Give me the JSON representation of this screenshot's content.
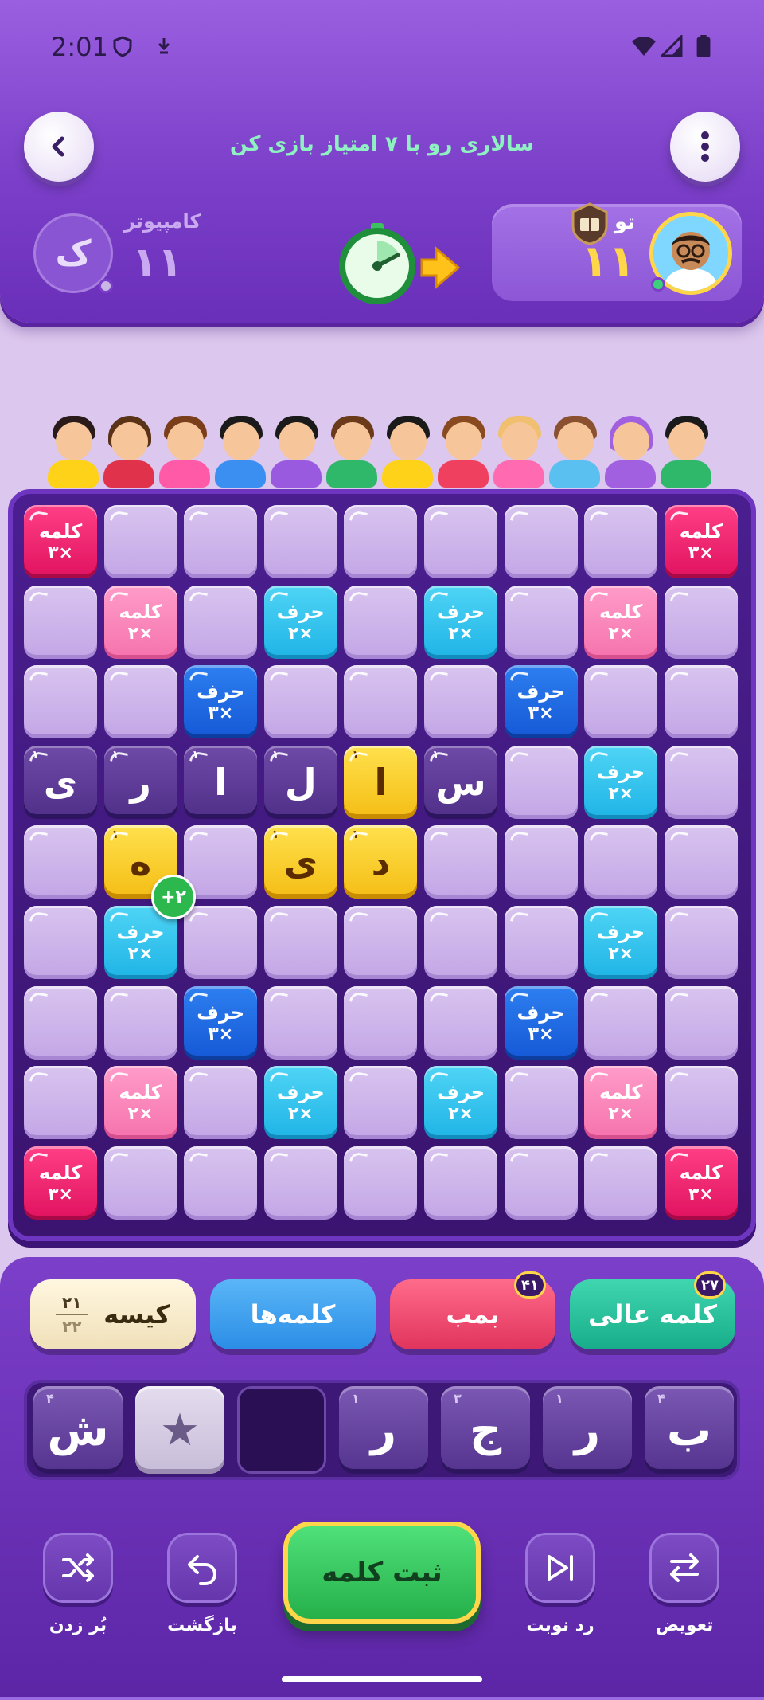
{
  "status_bar": {
    "time": "2:01"
  },
  "header": {
    "title": "سالاری رو با ۷ امتیاز بازی کن",
    "computer": {
      "name": "کامپیوتر",
      "avatar_letter": "ک",
      "score": "۱۱"
    },
    "player": {
      "name": "تو",
      "score": "۱۱"
    }
  },
  "board": {
    "premium_labels": {
      "tw": {
        "line1": "کلمه",
        "line2": "×۳"
      },
      "dw": {
        "line1": "کلمه",
        "line2": "×۲"
      },
      "dl": {
        "line1": "حرف",
        "line2": "×۲"
      },
      "tl": {
        "line1": "حرف",
        "line2": "×۳"
      }
    },
    "placed_tiles": [
      {
        "letter": "ی",
        "points": "۱",
        "owner": "opp"
      },
      {
        "letter": "ر",
        "points": "۱",
        "owner": "opp"
      },
      {
        "letter": "ا",
        "points": "۱",
        "owner": "opp"
      },
      {
        "letter": "ل",
        "points": "۱",
        "owner": "opp"
      },
      {
        "letter": "ا",
        "points": "۱",
        "owner": "mine"
      },
      {
        "letter": "س",
        "points": "۱",
        "owner": "opp"
      },
      {
        "letter": "ه",
        "points": "۱",
        "owner": "mine"
      },
      {
        "letter": "ی",
        "points": "۱",
        "owner": "mine"
      },
      {
        "letter": "د",
        "points": "۱",
        "owner": "mine"
      }
    ],
    "move_score": "+۲"
  },
  "powerups": {
    "bag": {
      "label": "کیسه",
      "count_top": "۲۱",
      "count_bottom": "۲۲"
    },
    "words": {
      "label": "کلمه‌ها"
    },
    "bomb": {
      "label": "بمب",
      "count": "۴۱"
    },
    "great_word": {
      "label": "کلمه عالی",
      "count": "۲۷"
    }
  },
  "rack": {
    "tiles": [
      {
        "letter": "ش",
        "points": "۴"
      },
      {
        "letter": "★",
        "points": ""
      },
      {
        "letter": "",
        "points": ""
      },
      {
        "letter": "ر",
        "points": "۱"
      },
      {
        "letter": "ج",
        "points": "۳"
      },
      {
        "letter": "ر",
        "points": "۱"
      },
      {
        "letter": "ب",
        "points": "۴"
      }
    ]
  },
  "actions": {
    "shuffle": "بُر زدن",
    "undo": "بازگشت",
    "submit": "ثبت کلمه",
    "pass": "رد نوبت",
    "swap": "تعویض"
  },
  "colors": {
    "header": "#7b3fc9",
    "title_text": "#8ff0c2",
    "score_gold": "#ffd54a",
    "submit_green": "#25b04a"
  }
}
